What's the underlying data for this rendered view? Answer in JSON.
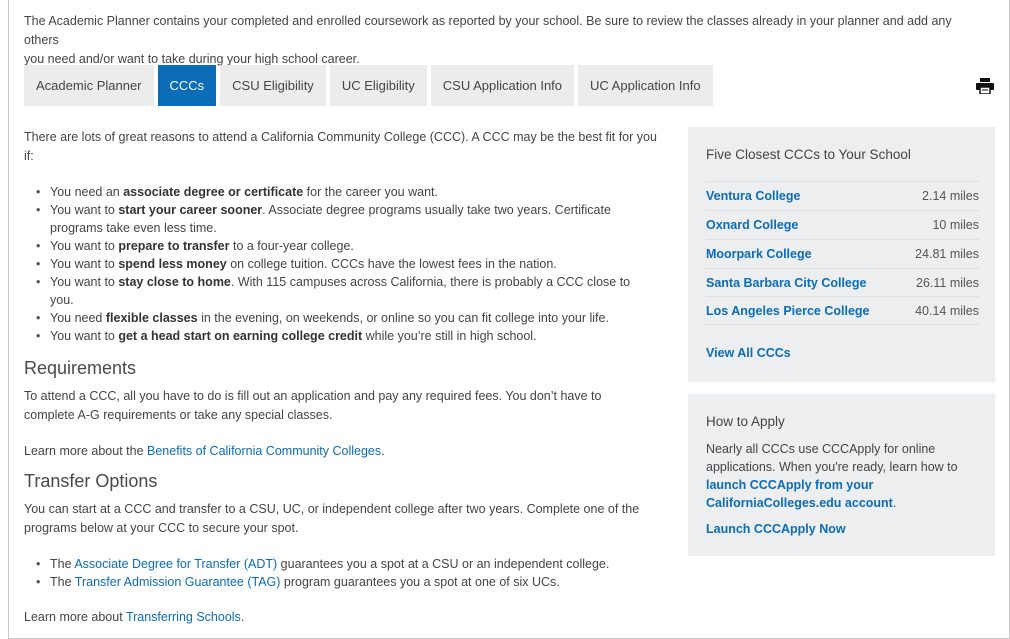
{
  "intro": {
    "line1": "The Academic Planner contains your completed and enrolled coursework as reported by your school. Be sure to review the classes already in your planner and add any others",
    "line2": "you need and/or want to take during your high school career."
  },
  "tabs": [
    {
      "label": "Academic Planner",
      "active": false
    },
    {
      "label": "CCCs",
      "active": true
    },
    {
      "label": "CSU Eligibility",
      "active": false
    },
    {
      "label": "UC Eligibility",
      "active": false
    },
    {
      "label": "CSU Application Info",
      "active": false
    },
    {
      "label": "UC Application Info",
      "active": false
    }
  ],
  "print_icon": "printer-icon",
  "main": {
    "lead": "There are lots of great reasons to attend a California Community College (CCC).  A CCC may be the best fit for you if:",
    "bullets": [
      {
        "pre": "You need an ",
        "bold": "associate degree or certificate",
        "post": " for the career you want."
      },
      {
        "pre": "You want to ",
        "bold": "start your career sooner",
        "post": ".  Associate degree programs usually take two years.  Certificate programs take even less time."
      },
      {
        "pre": "You want to ",
        "bold": "prepare to transfer",
        "post": " to a four-year college."
      },
      {
        "pre": "You want to ",
        "bold": "spend less money",
        "post": " on college tuition. CCCs have the lowest fees in the nation."
      },
      {
        "pre": "You want to ",
        "bold": "stay close to home",
        "post": ". With 115 campuses across California, there is probably a CCC close to you."
      },
      {
        "pre": "You need ",
        "bold": "flexible classes",
        "post": " in the evening, on weekends, or online so you can fit college into your life."
      },
      {
        "pre": "You want to ",
        "bold": "get a head start on earning college credit",
        "post": " while you’re still in high school."
      }
    ],
    "requirements_heading": "Requirements",
    "requirements_text": "To attend a CCC, all you have to do is fill out an application and pay any required fees. You don’t have to complete A-G requirements or take any special classes.",
    "learn_more_1_pre": "Learn more about the ",
    "learn_more_1_link": "Benefits of California Community Colleges",
    "learn_more_1_post": ".",
    "transfer_heading": "Transfer Options",
    "transfer_text": "You can start at a CCC and transfer to a CSU, UC, or independent college after two years. Complete one of the programs below at your CCC to secure your spot.",
    "transfer_bullets": [
      {
        "pre": "The ",
        "link": "Associate Degree for Transfer (ADT)",
        "post": " guarantees you a spot at a CSU or an independent college."
      },
      {
        "pre": "The ",
        "link": "Transfer Admission Guarantee (TAG)",
        "post": " program guarantees you a spot at one of six UCs."
      }
    ],
    "learn_more_2_pre": "Learn more about ",
    "learn_more_2_link": "Transferring Schools",
    "learn_more_2_post": "."
  },
  "closest": {
    "title": "Five Closest CCCs to Your School",
    "colleges": [
      {
        "name": "Ventura College",
        "distance": "2.14 miles"
      },
      {
        "name": "Oxnard College",
        "distance": "10 miles"
      },
      {
        "name": "Moorpark College",
        "distance": "24.81 miles"
      },
      {
        "name": "Santa Barbara City College",
        "distance": "26.11 miles"
      },
      {
        "name": "Los Angeles Pierce College",
        "distance": "40.14 miles"
      }
    ],
    "view_all": "View All CCCs"
  },
  "apply": {
    "title": "How to Apply",
    "text_pre": "Nearly all CCCs use CCCApply for online applications. When you're ready, learn how to ",
    "text_link": "launch CCCApply from your CaliforniaColleges.edu account",
    "text_post": ".",
    "launch": "Launch CCCApply Now"
  },
  "colors": {
    "accent": "#0b6cb8",
    "tab_bg": "#ececec",
    "card_bg": "#eceef0"
  }
}
